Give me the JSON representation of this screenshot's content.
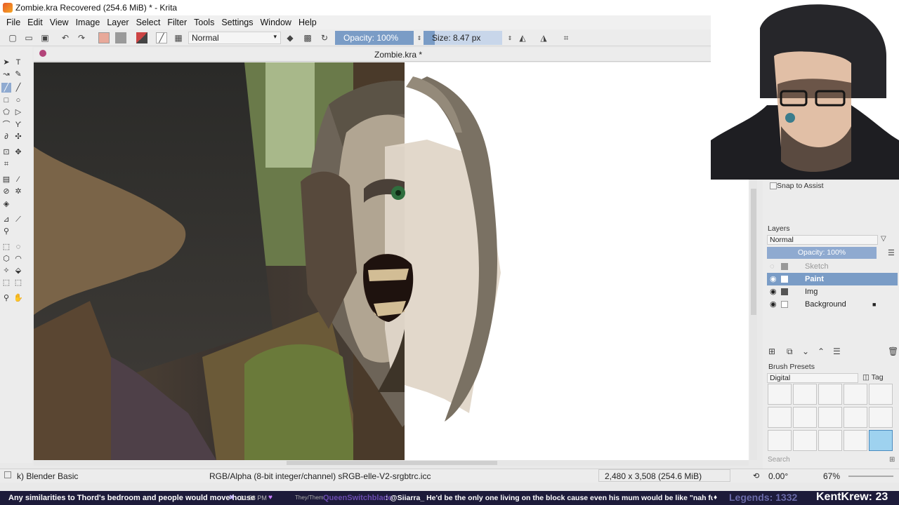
{
  "window": {
    "title": "Zombie.kra Recovered  (254.6 MiB)  * - Krita"
  },
  "menu": [
    "File",
    "Edit",
    "View",
    "Image",
    "Layer",
    "Select",
    "Filter",
    "Tools",
    "Settings",
    "Window",
    "Help"
  ],
  "toolbar": {
    "blend_mode": "Normal",
    "opacity_label": "Opacity: 100%",
    "opacity_fraction": 1.0,
    "size_label": "Size: 8.47 px"
  },
  "document": {
    "tab_title": "Zombie.kra *"
  },
  "dock": {
    "snap_label": "Snap to Assist",
    "layers_title": "Layers",
    "layers_blend": "Normal",
    "layers_opacity": "Opacity:  100%",
    "layers": [
      {
        "name": "Sketch",
        "selected": false,
        "visible": false
      },
      {
        "name": "Paint",
        "selected": true,
        "visible": true
      },
      {
        "name": "Img",
        "selected": false,
        "visible": true
      },
      {
        "name": "Background",
        "selected": false,
        "visible": true,
        "locked": true
      }
    ],
    "presets_title": "Brush Presets",
    "presets_tag_select": "Digital",
    "presets_tag_label": "Tag",
    "search_placeholder": "Search"
  },
  "status": {
    "brush": "k) Blender Basic",
    "color_profile": "RGB/Alpha (8-bit integer/channel)  sRGB-elle-V2-srgbtrc.icc",
    "dimensions": "2,480 x 3,508 (254.6 MiB)",
    "rotation": "0.00°",
    "zoom": "67%"
  },
  "ticker": {
    "text1": "Any similarities to Thord's bedroom and people would move house",
    "time": "11:58 PM",
    "pronoun": "They/Them",
    "user": "QueenSwitchblade",
    "msg": ": @Siiarra_ He'd be the only one living on the block cause even his mum would be like \"nah fuck that\"",
    "legends": "Legends: 1332",
    "counter": "KentKrew: 23"
  }
}
